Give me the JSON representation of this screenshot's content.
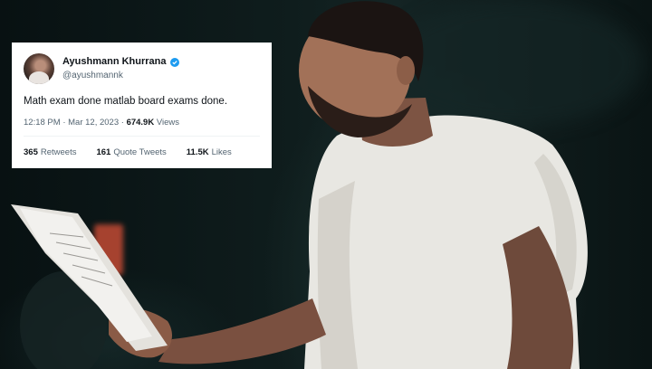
{
  "tweet": {
    "display_name": "Ayushmann Khurrana",
    "handle": "@ayushmannk",
    "text": "Math exam done matlab board exams done.",
    "time": "12:18 PM",
    "date": "Mar 12, 2023",
    "views_count": "674.9K",
    "views_label": "Views",
    "retweets_count": "365",
    "retweets_label": "Retweets",
    "quote_tweets_count": "161",
    "quote_tweets_label": "Quote Tweets",
    "likes_count": "11.5K",
    "likes_label": "Likes"
  },
  "icons": {
    "verified": "verified-badge-icon"
  },
  "colors": {
    "verified_blue": "#1d9bf0",
    "background": "#0d1616",
    "shirt": "#ecebe6"
  }
}
